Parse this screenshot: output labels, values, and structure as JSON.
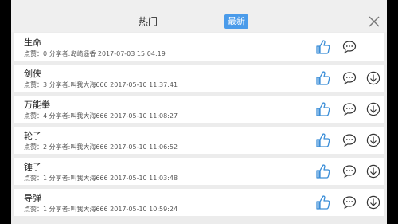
{
  "header": {
    "tab_hot": "热门",
    "tab_new": "最新"
  },
  "items": [
    {
      "title": "生命",
      "meta": "点赞：0  分享者:岛崎遥香  2017-07-03 15:04:19",
      "has_download": false
    },
    {
      "title": "剑侠",
      "meta": "点赞：3  分享者:叫我大海666  2017-05-10 11:37:41",
      "has_download": true
    },
    {
      "title": "万能拳",
      "meta": "点赞：4  分享者:叫我大海666  2017-05-10 11:08:27",
      "has_download": true
    },
    {
      "title": "轮子",
      "meta": "点赞：2  分享者:叫我大海666  2017-05-10 11:06:52",
      "has_download": true
    },
    {
      "title": "锤子",
      "meta": "点赞：1  分享者:叫我大海666  2017-05-10 11:03:48",
      "has_download": true
    },
    {
      "title": "导弹",
      "meta": "点赞：1  分享者:叫我大海666  2017-05-10 10:59:24",
      "has_download": true
    }
  ],
  "icons": {
    "like": "thumbs-up-icon",
    "comment": "comment-icon",
    "download": "download-icon",
    "close": "close-icon"
  },
  "colors": {
    "accent": "#4a9bea",
    "like_icon": "#3d8fd8"
  }
}
